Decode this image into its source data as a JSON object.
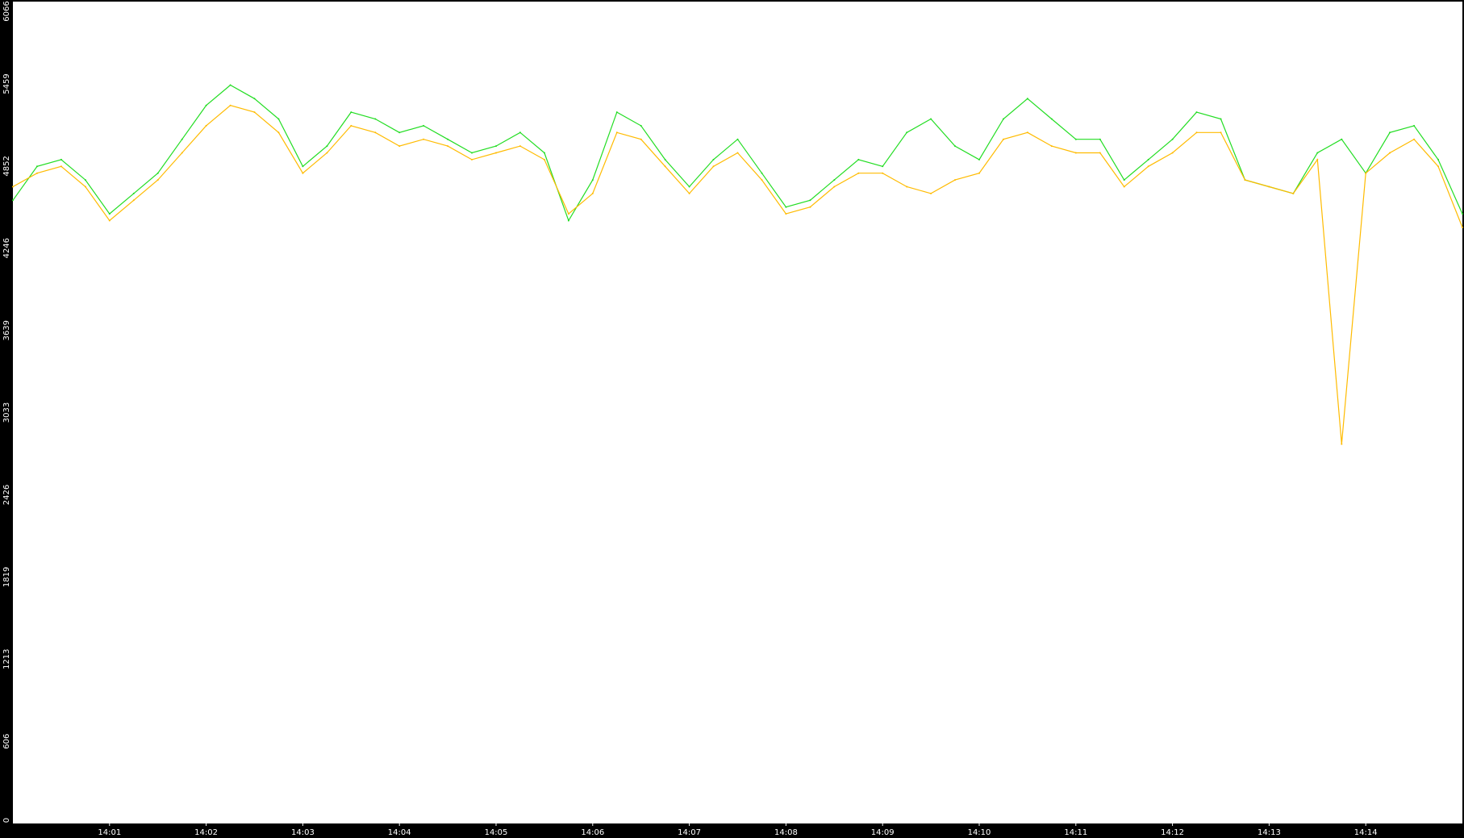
{
  "chart_data": {
    "type": "line",
    "title": "",
    "xlabel": "",
    "ylabel": "",
    "background": "#ffffff",
    "frame_color": "#000000",
    "tick_label_color": "#ffffff",
    "grid": false,
    "legend": "none",
    "ylim": [
      0,
      6066
    ],
    "xlim": [
      "14:00:00",
      "14:15:00"
    ],
    "y_ticks": [
      0,
      606,
      1213,
      1819,
      2426,
      3033,
      3639,
      4246,
      4852,
      5459,
      6066
    ],
    "y_tick_labels": [
      "0",
      "606",
      "1213",
      "1819",
      "2426",
      "3033",
      "3639",
      "4246",
      "4852",
      "5459",
      "6066"
    ],
    "x_ticks": [
      "14:01",
      "14:02",
      "14:03",
      "14:04",
      "14:05",
      "14:06",
      "14:07",
      "14:08",
      "14:09",
      "14:10",
      "14:11",
      "14:12",
      "14:13",
      "14:14"
    ],
    "series": [
      {
        "color": "#22dd22",
        "x": [
          "14:00:00",
          "14:00:15",
          "14:00:30",
          "14:00:45",
          "14:01:00",
          "14:01:15",
          "14:01:30",
          "14:01:45",
          "14:02:00",
          "14:02:15",
          "14:02:30",
          "14:02:45",
          "14:03:00",
          "14:03:15",
          "14:03:30",
          "14:03:45",
          "14:04:00",
          "14:04:15",
          "14:04:30",
          "14:04:45",
          "14:05:00",
          "14:05:15",
          "14:05:30",
          "14:05:45",
          "14:06:00",
          "14:06:15",
          "14:06:30",
          "14:06:45",
          "14:07:00",
          "14:07:15",
          "14:07:30",
          "14:07:45",
          "14:08:00",
          "14:08:15",
          "14:08:30",
          "14:08:45",
          "14:09:00",
          "14:09:15",
          "14:09:30",
          "14:09:45",
          "14:10:00",
          "14:10:15",
          "14:10:30",
          "14:10:45",
          "14:11:00",
          "14:11:15",
          "14:11:30",
          "14:11:45",
          "14:12:00",
          "14:12:15",
          "14:12:30",
          "14:12:45",
          "14:13:00",
          "14:13:15",
          "14:13:30",
          "14:13:45",
          "14:14:00",
          "14:14:15",
          "14:14:30",
          "14:14:45",
          "14:15:00"
        ],
        "y": [
          4600,
          4850,
          4900,
          4750,
          4500,
          4650,
          4800,
          5050,
          5300,
          5450,
          5350,
          5200,
          4850,
          5000,
          5250,
          5200,
          5100,
          5150,
          5050,
          4950,
          5000,
          5100,
          4950,
          4450,
          4750,
          5250,
          5150,
          4900,
          4700,
          4900,
          5050,
          4800,
          4550,
          4600,
          4750,
          4900,
          4850,
          5100,
          5200,
          5000,
          4900,
          5200,
          5350,
          5200,
          5050,
          5050,
          4750,
          4900,
          5050,
          5250,
          5200,
          4750,
          4700,
          4650,
          4950,
          5050,
          4800,
          5100,
          5150,
          4900,
          4500
        ]
      },
      {
        "color": "#ffbb00",
        "x": [
          "14:00:00",
          "14:00:15",
          "14:00:30",
          "14:00:45",
          "14:01:00",
          "14:01:15",
          "14:01:30",
          "14:01:45",
          "14:02:00",
          "14:02:15",
          "14:02:30",
          "14:02:45",
          "14:03:00",
          "14:03:15",
          "14:03:30",
          "14:03:45",
          "14:04:00",
          "14:04:15",
          "14:04:30",
          "14:04:45",
          "14:05:00",
          "14:05:15",
          "14:05:30",
          "14:05:45",
          "14:06:00",
          "14:06:15",
          "14:06:30",
          "14:06:45",
          "14:07:00",
          "14:07:15",
          "14:07:30",
          "14:07:45",
          "14:08:00",
          "14:08:15",
          "14:08:30",
          "14:08:45",
          "14:09:00",
          "14:09:15",
          "14:09:30",
          "14:09:45",
          "14:10:00",
          "14:10:15",
          "14:10:30",
          "14:10:45",
          "14:11:00",
          "14:11:15",
          "14:11:30",
          "14:11:45",
          "14:12:00",
          "14:12:15",
          "14:12:30",
          "14:12:45",
          "14:13:00",
          "14:13:15",
          "14:13:30",
          "14:13:45",
          "14:14:00",
          "14:14:15",
          "14:14:30",
          "14:14:45",
          "14:15:00"
        ],
        "y": [
          4700,
          4800,
          4850,
          4700,
          4450,
          4600,
          4750,
          4950,
          5150,
          5300,
          5250,
          5100,
          4800,
          4950,
          5150,
          5100,
          5000,
          5050,
          5000,
          4900,
          4950,
          5000,
          4900,
          4500,
          4650,
          5100,
          5050,
          4850,
          4650,
          4850,
          4950,
          4750,
          4500,
          4550,
          4700,
          4800,
          4800,
          4700,
          4650,
          4750,
          4800,
          5050,
          5100,
          5000,
          4950,
          4950,
          4700,
          4850,
          4950,
          5100,
          5100,
          4750,
          4700,
          4650,
          4900,
          2800,
          4800,
          4950,
          5050,
          4850,
          4400
        ]
      }
    ]
  }
}
